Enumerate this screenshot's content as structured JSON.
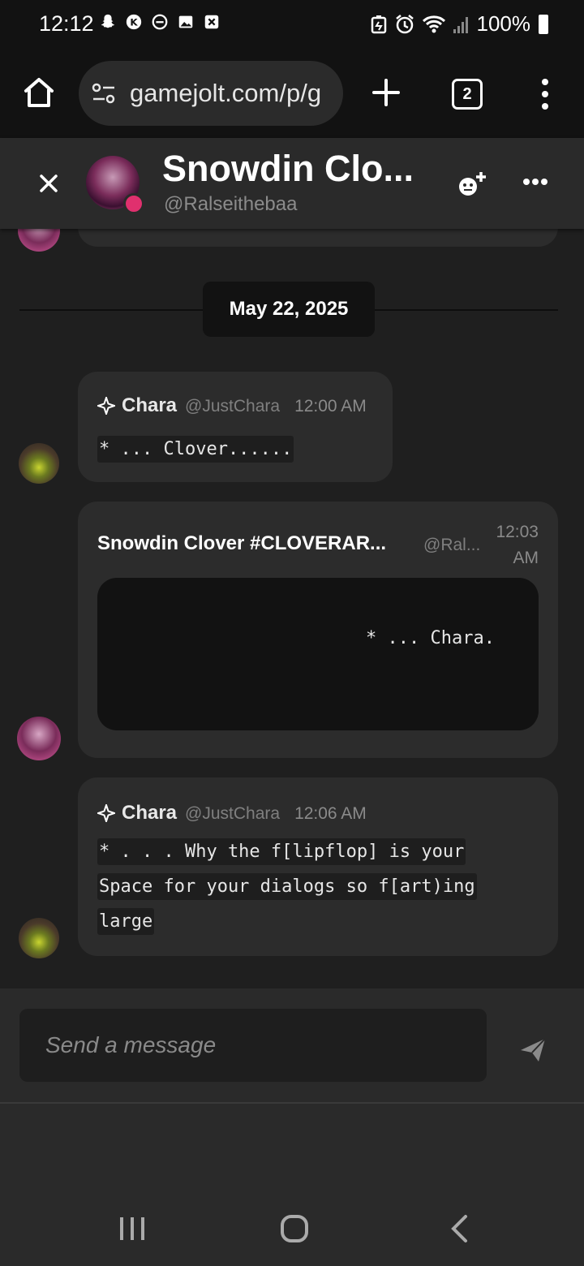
{
  "status_bar": {
    "time": "12:12",
    "battery": "100%",
    "left_icons": [
      "snapchat-icon",
      "kick-icon",
      "dnd-icon",
      "gallery-icon",
      "close-box-icon"
    ],
    "right_icons": [
      "battery-saver-icon",
      "alarm-icon",
      "wifi-icon",
      "signal-icon"
    ]
  },
  "browser": {
    "url": "gamejolt.com/p/g",
    "tab_count": "2"
  },
  "chat_header": {
    "title": "Snowdin Clo...",
    "handle": "@Ralseithebaa",
    "online_color": "#e0306e"
  },
  "date_separator": "May 22, 2025",
  "messages": [
    {
      "sender": "Chara",
      "handle": "@JustChara",
      "time": "12:00 AM",
      "lines": [
        "* ... Clover......"
      ]
    },
    {
      "sender": "Snowdin Clover #CLOVERAR...",
      "handle": "@Ral...",
      "time": "12:03 AM",
      "quote": "* ... Chara."
    },
    {
      "sender": "Chara",
      "handle": "@JustChara",
      "time": "12:06 AM",
      "lines": [
        "* . . . Why the f[lipflop] is your",
        "Space for your dialogs so f[art)ing",
        "large"
      ]
    }
  ],
  "compose": {
    "placeholder": "Send a message"
  },
  "colors": {
    "background": "#1f1f1f",
    "bubble": "#2c2c2c",
    "header": "#2a2a2a"
  }
}
